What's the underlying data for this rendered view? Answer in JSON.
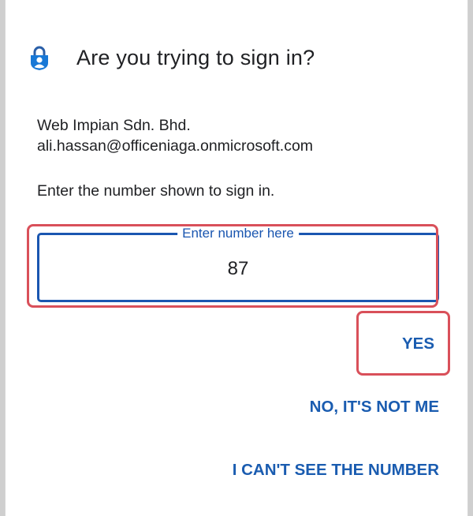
{
  "dialog": {
    "title": "Are you trying to sign in?",
    "organization": "Web Impian Sdn. Bhd.",
    "email": "ali.hassan@officeniaga.onmicrosoft.com",
    "instruction": "Enter the number shown to sign in.",
    "number_field": {
      "label": "Enter number here",
      "value": "87"
    },
    "buttons": {
      "yes": "YES",
      "no": "NO, IT'S NOT ME",
      "cant_see": "I CAN'T SEE THE NUMBER"
    }
  },
  "icons": {
    "app": "microsoft-authenticator-icon"
  },
  "colors": {
    "accent": "#1a56b0",
    "highlight": "#d9505a",
    "text": "#202124"
  }
}
